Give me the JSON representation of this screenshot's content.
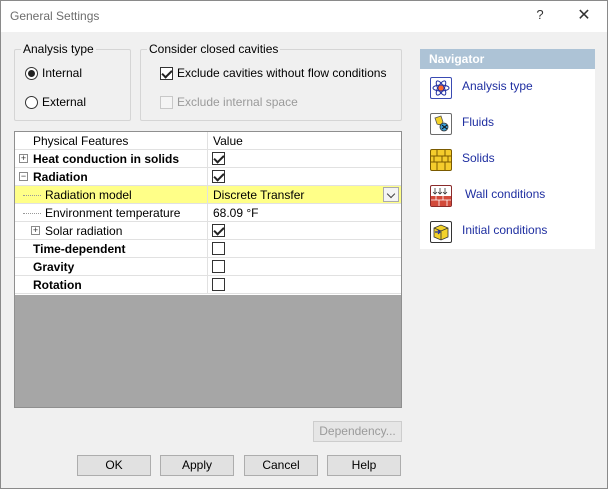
{
  "window": {
    "title": "General Settings",
    "help_glyph": "?",
    "close_glyph": "✕"
  },
  "analysis_type": {
    "legend": "Analysis type",
    "options": [
      {
        "label": "Internal",
        "selected": true
      },
      {
        "label": "External",
        "selected": false
      }
    ]
  },
  "cavities": {
    "legend": "Consider closed cavities",
    "exclude_no_flow": {
      "label": "Exclude cavities without flow conditions",
      "checked": true
    },
    "exclude_internal": {
      "label": "Exclude internal space",
      "checked": false,
      "disabled": true
    }
  },
  "grid": {
    "headers": [
      "Physical Features",
      "Value"
    ],
    "rows": [
      {
        "label": "Heat conduction in solids",
        "value_type": "checkbox",
        "checked": true
      },
      {
        "label": "Radiation",
        "value_type": "checkbox",
        "checked": true
      },
      {
        "label": "Radiation model",
        "value_type": "dropdown",
        "value": "Discrete Transfer"
      },
      {
        "label": "Environment temperature",
        "value_type": "text",
        "value": "68.09 °F"
      },
      {
        "label": "Solar radiation",
        "value_type": "checkbox",
        "checked": true
      },
      {
        "label": "Time-dependent",
        "value_type": "checkbox",
        "checked": false
      },
      {
        "label": "Gravity",
        "value_type": "checkbox",
        "checked": false
      },
      {
        "label": "Rotation",
        "value_type": "checkbox",
        "checked": false
      }
    ],
    "expander_glyphs": {
      "plus": "+",
      "minus": "−"
    }
  },
  "navigator": {
    "header": "Navigator",
    "items": [
      {
        "label": "Analysis type",
        "icon": "analysis-type-icon"
      },
      {
        "label": "Fluids",
        "icon": "fluids-icon"
      },
      {
        "label": "Solids",
        "icon": "solids-icon"
      },
      {
        "label": "Wall conditions",
        "icon": "wall-conditions-icon"
      },
      {
        "label": "Initial conditions",
        "icon": "initial-conditions-icon"
      }
    ]
  },
  "buttons": {
    "dependency": "Dependency...",
    "ok": "OK",
    "apply": "Apply",
    "cancel": "Cancel",
    "help": "Help"
  },
  "colors": {
    "highlight": "#ffff88",
    "nav_header": "#adc3d6",
    "link": "#1f2fa1",
    "grid_empty": "#a6a6a6"
  }
}
